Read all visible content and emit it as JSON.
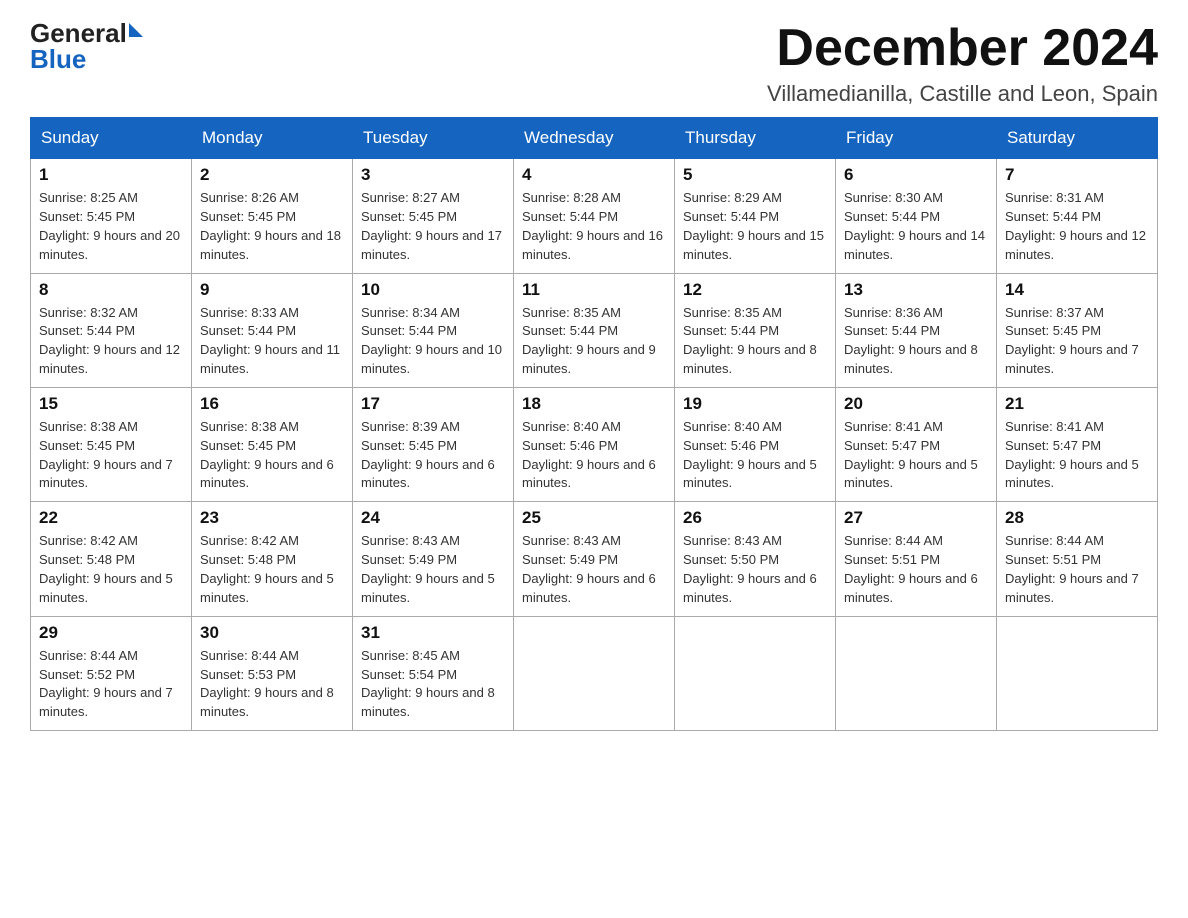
{
  "header": {
    "logo_general": "General",
    "logo_blue": "Blue",
    "month_title": "December 2024",
    "location": "Villamedianilla, Castille and Leon, Spain"
  },
  "weekdays": [
    "Sunday",
    "Monday",
    "Tuesday",
    "Wednesday",
    "Thursday",
    "Friday",
    "Saturday"
  ],
  "weeks": [
    [
      {
        "day": "1",
        "sunrise": "8:25 AM",
        "sunset": "5:45 PM",
        "daylight": "9 hours and 20 minutes."
      },
      {
        "day": "2",
        "sunrise": "8:26 AM",
        "sunset": "5:45 PM",
        "daylight": "9 hours and 18 minutes."
      },
      {
        "day": "3",
        "sunrise": "8:27 AM",
        "sunset": "5:45 PM",
        "daylight": "9 hours and 17 minutes."
      },
      {
        "day": "4",
        "sunrise": "8:28 AM",
        "sunset": "5:44 PM",
        "daylight": "9 hours and 16 minutes."
      },
      {
        "day": "5",
        "sunrise": "8:29 AM",
        "sunset": "5:44 PM",
        "daylight": "9 hours and 15 minutes."
      },
      {
        "day": "6",
        "sunrise": "8:30 AM",
        "sunset": "5:44 PM",
        "daylight": "9 hours and 14 minutes."
      },
      {
        "day": "7",
        "sunrise": "8:31 AM",
        "sunset": "5:44 PM",
        "daylight": "9 hours and 12 minutes."
      }
    ],
    [
      {
        "day": "8",
        "sunrise": "8:32 AM",
        "sunset": "5:44 PM",
        "daylight": "9 hours and 12 minutes."
      },
      {
        "day": "9",
        "sunrise": "8:33 AM",
        "sunset": "5:44 PM",
        "daylight": "9 hours and 11 minutes."
      },
      {
        "day": "10",
        "sunrise": "8:34 AM",
        "sunset": "5:44 PM",
        "daylight": "9 hours and 10 minutes."
      },
      {
        "day": "11",
        "sunrise": "8:35 AM",
        "sunset": "5:44 PM",
        "daylight": "9 hours and 9 minutes."
      },
      {
        "day": "12",
        "sunrise": "8:35 AM",
        "sunset": "5:44 PM",
        "daylight": "9 hours and 8 minutes."
      },
      {
        "day": "13",
        "sunrise": "8:36 AM",
        "sunset": "5:44 PM",
        "daylight": "9 hours and 8 minutes."
      },
      {
        "day": "14",
        "sunrise": "8:37 AM",
        "sunset": "5:45 PM",
        "daylight": "9 hours and 7 minutes."
      }
    ],
    [
      {
        "day": "15",
        "sunrise": "8:38 AM",
        "sunset": "5:45 PM",
        "daylight": "9 hours and 7 minutes."
      },
      {
        "day": "16",
        "sunrise": "8:38 AM",
        "sunset": "5:45 PM",
        "daylight": "9 hours and 6 minutes."
      },
      {
        "day": "17",
        "sunrise": "8:39 AM",
        "sunset": "5:45 PM",
        "daylight": "9 hours and 6 minutes."
      },
      {
        "day": "18",
        "sunrise": "8:40 AM",
        "sunset": "5:46 PM",
        "daylight": "9 hours and 6 minutes."
      },
      {
        "day": "19",
        "sunrise": "8:40 AM",
        "sunset": "5:46 PM",
        "daylight": "9 hours and 5 minutes."
      },
      {
        "day": "20",
        "sunrise": "8:41 AM",
        "sunset": "5:47 PM",
        "daylight": "9 hours and 5 minutes."
      },
      {
        "day": "21",
        "sunrise": "8:41 AM",
        "sunset": "5:47 PM",
        "daylight": "9 hours and 5 minutes."
      }
    ],
    [
      {
        "day": "22",
        "sunrise": "8:42 AM",
        "sunset": "5:48 PM",
        "daylight": "9 hours and 5 minutes."
      },
      {
        "day": "23",
        "sunrise": "8:42 AM",
        "sunset": "5:48 PM",
        "daylight": "9 hours and 5 minutes."
      },
      {
        "day": "24",
        "sunrise": "8:43 AM",
        "sunset": "5:49 PM",
        "daylight": "9 hours and 5 minutes."
      },
      {
        "day": "25",
        "sunrise": "8:43 AM",
        "sunset": "5:49 PM",
        "daylight": "9 hours and 6 minutes."
      },
      {
        "day": "26",
        "sunrise": "8:43 AM",
        "sunset": "5:50 PM",
        "daylight": "9 hours and 6 minutes."
      },
      {
        "day": "27",
        "sunrise": "8:44 AM",
        "sunset": "5:51 PM",
        "daylight": "9 hours and 6 minutes."
      },
      {
        "day": "28",
        "sunrise": "8:44 AM",
        "sunset": "5:51 PM",
        "daylight": "9 hours and 7 minutes."
      }
    ],
    [
      {
        "day": "29",
        "sunrise": "8:44 AM",
        "sunset": "5:52 PM",
        "daylight": "9 hours and 7 minutes."
      },
      {
        "day": "30",
        "sunrise": "8:44 AM",
        "sunset": "5:53 PM",
        "daylight": "9 hours and 8 minutes."
      },
      {
        "day": "31",
        "sunrise": "8:45 AM",
        "sunset": "5:54 PM",
        "daylight": "9 hours and 8 minutes."
      },
      null,
      null,
      null,
      null
    ]
  ]
}
